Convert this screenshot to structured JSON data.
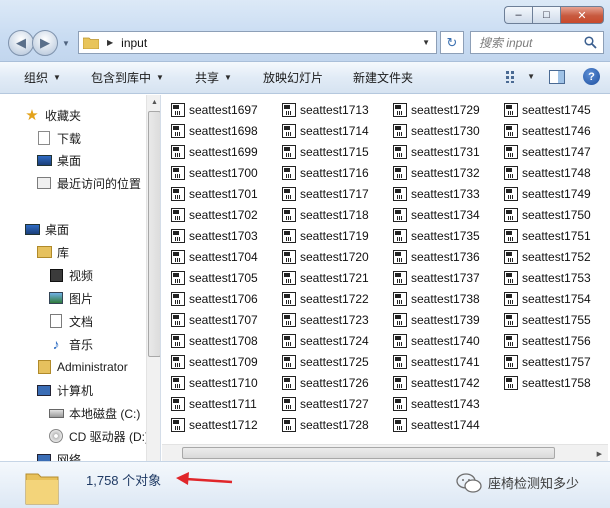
{
  "window": {
    "minimize_icon": "minimize-icon",
    "maximize_icon": "maximize-icon",
    "close_icon": "close-icon"
  },
  "address": {
    "path": "input"
  },
  "search": {
    "placeholder": "搜索 input"
  },
  "toolbar": {
    "organize": "组织",
    "include_in_library": "包含到库中",
    "share": "共享",
    "slideshow": "放映幻灯片",
    "new_folder": "新建文件夹"
  },
  "nav": {
    "favorites": "收藏夹",
    "downloads": "下载",
    "desktop_fav": "桌面",
    "recent_places": "最近访问的位置",
    "desktop": "桌面",
    "libraries": "库",
    "videos": "视频",
    "pictures": "图片",
    "documents": "文档",
    "music": "音乐",
    "user": "Administrator",
    "computer": "计算机",
    "local_disk": "本地磁盘 (C:)",
    "cd_drive": "CD 驱动器 (D:)",
    "network": "网络"
  },
  "files": {
    "columns": [
      [
        "seattest1697",
        "seattest1698",
        "seattest1699",
        "seattest1700",
        "seattest1701",
        "seattest1702",
        "seattest1703",
        "seattest1704",
        "seattest1705",
        "seattest1706",
        "seattest1707",
        "seattest1708",
        "seattest1709",
        "seattest1710",
        "seattest1711",
        "seattest1712"
      ],
      [
        "seattest1713",
        "seattest1714",
        "seattest1715",
        "seattest1716",
        "seattest1717",
        "seattest1718",
        "seattest1719",
        "seattest1720",
        "seattest1721",
        "seattest1722",
        "seattest1723",
        "seattest1724",
        "seattest1725",
        "seattest1726",
        "seattest1727",
        "seattest1728"
      ],
      [
        "seattest1729",
        "seattest1730",
        "seattest1731",
        "seattest1732",
        "seattest1733",
        "seattest1734",
        "seattest1735",
        "seattest1736",
        "seattest1737",
        "seattest1738",
        "seattest1739",
        "seattest1740",
        "seattest1741",
        "seattest1742",
        "seattest1743",
        "seattest1744"
      ],
      [
        "seattest1745",
        "seattest1746",
        "seattest1747",
        "seattest1748",
        "seattest1749",
        "seattest1750",
        "seattest1751",
        "seattest1752",
        "seattest1753",
        "seattest1754",
        "seattest1755",
        "seattest1756",
        "seattest1757",
        "seattest1758"
      ]
    ]
  },
  "details": {
    "object_count": "1,758 个对象",
    "watermark": "座椅检测知多少"
  },
  "colors": {
    "annotation_arrow": "#e0262a",
    "accent": "#3a6fb0"
  }
}
